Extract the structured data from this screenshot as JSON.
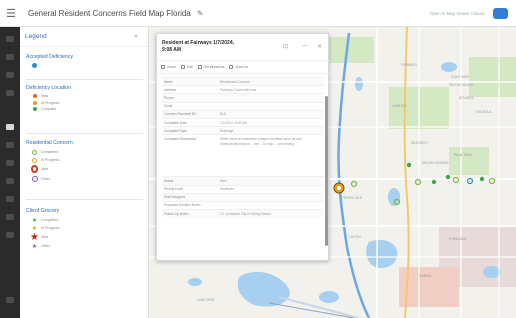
{
  "header": {
    "title": "General Resident Concerns Field Map Florida",
    "right_link": "Open in Map Viewer Classic"
  },
  "legend": {
    "title": "Legend",
    "sections": [
      {
        "title": "Accepted Deficiency",
        "items": [
          {
            "label": "",
            "symbol": "dot",
            "color": "#2a8fd0"
          }
        ]
      },
      {
        "title": "Deficiency Location",
        "items": [
          {
            "label": "New",
            "symbol": "dot",
            "color": "#e8651a"
          },
          {
            "label": "In Progress",
            "symbol": "dot",
            "color": "#e8a21a"
          },
          {
            "label": "Complete",
            "symbol": "dot",
            "color": "#3aa845"
          }
        ]
      },
      {
        "title": "Residential Concern",
        "items": [
          {
            "label": "Completed",
            "symbol": "ring",
            "color": "#7ab648"
          },
          {
            "label": "In Progress",
            "symbol": "ring",
            "color": "#e8a21a"
          },
          {
            "label": "New",
            "symbol": "ring",
            "color": "#d0361c"
          },
          {
            "label": "Other",
            "symbol": "ring",
            "color": "#8a4fbf"
          }
        ]
      },
      {
        "title": "Client Grocery",
        "items": [
          {
            "label": "Completed",
            "symbol": "star",
            "color": "#3aa845"
          },
          {
            "label": "In Progress",
            "symbol": "star",
            "color": "#e8a21a"
          },
          {
            "label": "New",
            "symbol": "star",
            "color": "#c0281a"
          },
          {
            "label": "Other",
            "symbol": "star",
            "color": "#8a4fbf"
          }
        ]
      }
    ]
  },
  "popup": {
    "title": "Resident at Fairways 1/7/2024, 9:08 AM",
    "actions": [
      "Zoom",
      "Edit",
      "Get directions",
      "Zoom to"
    ],
    "rows": [
      {
        "key": "Name",
        "value": "Residential Concern"
      },
      {
        "key": "Address",
        "value": "Fairways Condominiums"
      },
      {
        "key": "Phone",
        "value": ""
      },
      {
        "key": "Email",
        "value": ""
      },
      {
        "key": "Concern Received BY",
        "value": "BLS"
      },
      {
        "key": "Complaint Date",
        "value": "1/7/2024, 9:08 AM"
      },
      {
        "key": "Complaint Type",
        "value": "Drainage"
      },
      {
        "key": "Complaint Description",
        "value": "While minor at evaluation bridges condition were as and ... Sinkhole/depression ... the ... to stop ... concerning ... "
      },
      {
        "key": "Status",
        "value": "New"
      },
      {
        "key": "Priority Level",
        "value": "Moderate"
      },
      {
        "key": "Staff Assigned",
        "value": ""
      },
      {
        "key": "Proposed Solution Notes",
        "value": ""
      },
      {
        "key": "Follow-Up Notes",
        "value": "1/7 contacted City of Delray Beach"
      }
    ]
  },
  "map": {
    "labels": [
      "FAIRWAYS",
      "GOLF VIEW",
      "DELRAY BEACH",
      "LAKE IDA",
      "ATLANTIC",
      "SEACREST",
      "PALM TRAIL",
      "OSCEOLA",
      "TROPIC ISLE",
      "DELRAY SHORES",
      "MARINA",
      "LAKE VIEW",
      "LINTON",
      "POINCIANA"
    ]
  },
  "colors": {
    "accent": "#2f6db0",
    "rail": "#2b2b2b",
    "water": "#a6cff0",
    "park": "#d4e8c4",
    "road_major": "#f5c86a"
  }
}
